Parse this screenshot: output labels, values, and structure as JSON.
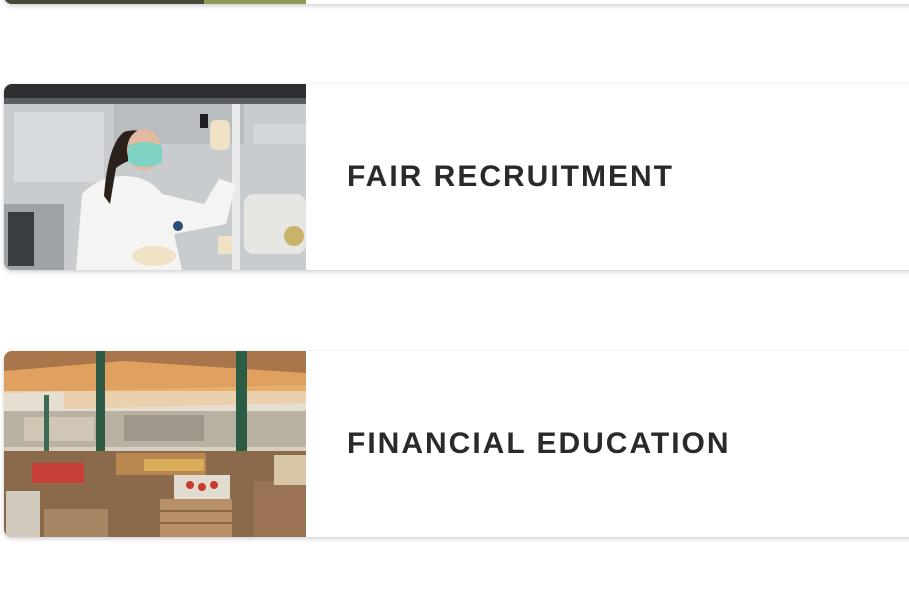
{
  "cards": [
    {
      "title": "",
      "image": "partial-photo-card"
    },
    {
      "title": "FAIR RECRUITMENT",
      "image": "lab-worker-photo"
    },
    {
      "title": "FINANCIAL EDUCATION",
      "image": "market-stalls-photo"
    }
  ]
}
